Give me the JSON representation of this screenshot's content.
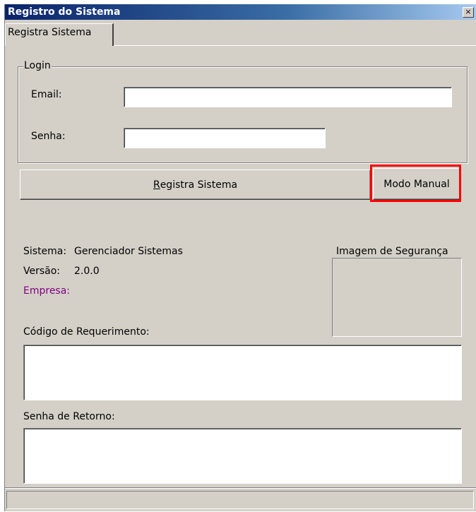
{
  "window": {
    "title": "Registro do Sistema",
    "close_glyph": "×"
  },
  "tabs": [
    {
      "label": "Registra Sistema",
      "active": true
    }
  ],
  "login": {
    "legend": "Login",
    "email_label": "Email:",
    "email_value": "",
    "senha_label": "Senha:",
    "senha_value": ""
  },
  "buttons": {
    "registra_prefix": "R",
    "registra_rest": "egistra Sistema",
    "manual_label": "Modo Manual"
  },
  "info": {
    "sistema_label": "Sistema:",
    "sistema_value": "Gerenciador Sistemas",
    "versao_label": "Versão:",
    "versao_value": "2.0.0",
    "empresa_label": "Empresa:",
    "empresa_color": "#800080",
    "imagem_label": "Imagem de Segurança"
  },
  "requerimento": {
    "label": "Código de Requerimento:",
    "value": ""
  },
  "retorno": {
    "label": "Senha de Retorno:",
    "value": ""
  },
  "colors": {
    "highlight": "#ff0000",
    "window_bg": "#d4d0c8"
  }
}
